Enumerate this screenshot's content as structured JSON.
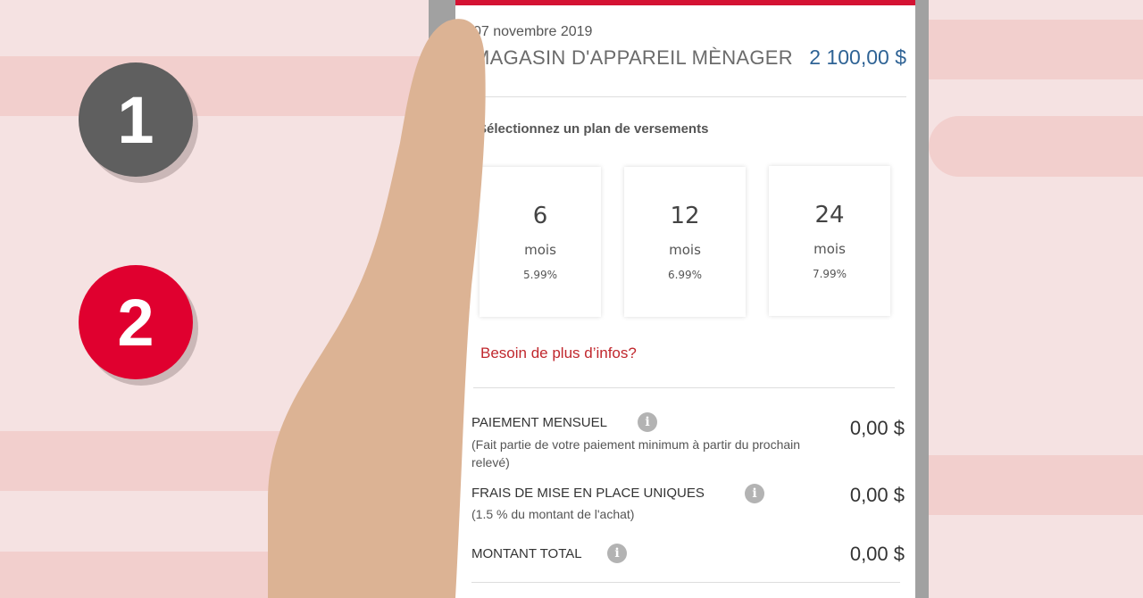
{
  "badges": [
    {
      "label": "1",
      "color": "#5f5f5f"
    },
    {
      "label": "2",
      "color": "#e0002f"
    }
  ],
  "transaction": {
    "date": "07 novembre 2019",
    "merchant": "MAGASIN D'APPAREIL MÈNAGER",
    "amount": "2 100,00 $"
  },
  "plan_section": {
    "title": "Sélectionnez un plan de versements",
    "plans": [
      {
        "months": "6",
        "unit": "mois",
        "rate": "5.99%"
      },
      {
        "months": "12",
        "unit": "mois",
        "rate": "6.99%"
      },
      {
        "months": "24",
        "unit": "mois",
        "rate": "7.99%"
      }
    ],
    "info_link": "Besoin de plus d’infos?"
  },
  "summary": {
    "monthly": {
      "label": "PAIEMENT MENSUEL",
      "note": "(Fait partie de votre paiement minimum à partir du prochain relevé)",
      "value": "0,00 $"
    },
    "setup_fee": {
      "label": "FRAIS DE MISE EN PLACE UNIQUES",
      "note": "(1.5 % du montant de l'achat)",
      "value": "0,00 $"
    },
    "total": {
      "label": "MONTANT TOTAL",
      "value": "0,00 $"
    },
    "info_icon": "i"
  },
  "colors": {
    "accent_red": "#d41233",
    "amount_blue": "#2f6395",
    "link_red": "#c0272d",
    "skin": "#dcb394"
  }
}
